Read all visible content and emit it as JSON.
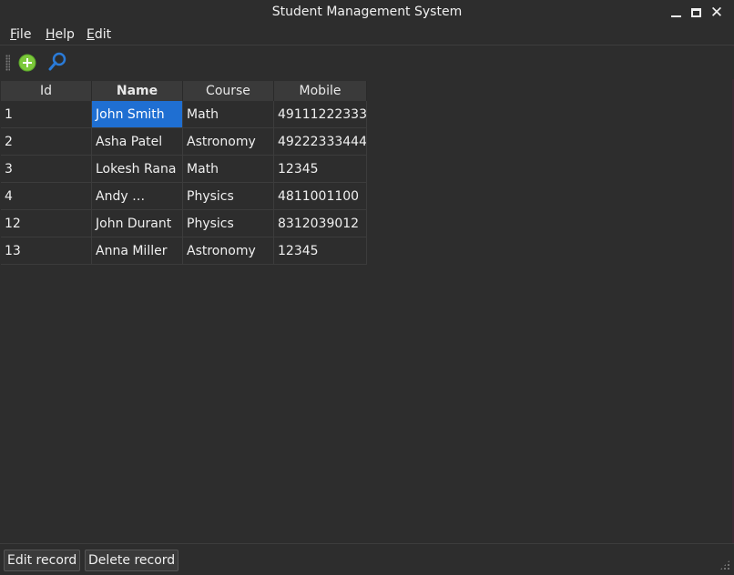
{
  "window": {
    "title": "Student Management System"
  },
  "menu": {
    "items": [
      {
        "mnemonic": "F",
        "rest": "ile"
      },
      {
        "mnemonic": "H",
        "rest": "elp"
      },
      {
        "mnemonic": "E",
        "rest": "dit"
      }
    ]
  },
  "toolbar": {
    "icons": [
      "add-icon",
      "search-icon"
    ]
  },
  "table": {
    "columns": [
      "Id",
      "Name",
      "Course",
      "Mobile"
    ],
    "rows": [
      [
        "1",
        "John Smith",
        "Math",
        "49111222333"
      ],
      [
        "2",
        "Asha Patel",
        "Astronomy",
        "49222333444"
      ],
      [
        "3",
        "Lokesh Rana",
        "Math",
        "12345"
      ],
      [
        "4",
        "Andy …",
        "Physics",
        "4811001100"
      ],
      [
        "12",
        "John Durant",
        "Physics",
        "8312039012"
      ],
      [
        "13",
        "Anna Miller",
        "Astronomy",
        "12345"
      ]
    ],
    "selected": {
      "row": 0,
      "column": 1
    }
  },
  "buttons": {
    "edit": "Edit record",
    "delete": "Delete record"
  },
  "colors": {
    "selection": "#1f6fd2",
    "add_icon": "#7cc93a",
    "search_icon": "#2a7bd8"
  }
}
